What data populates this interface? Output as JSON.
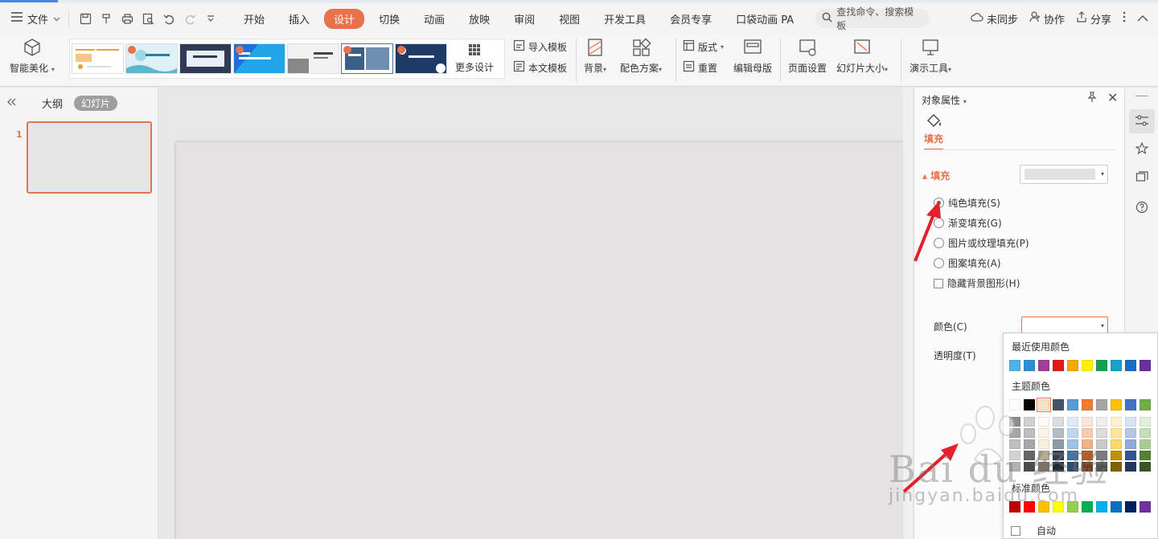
{
  "menubar": {
    "file_label": "文件",
    "tabs": [
      {
        "label": "开始",
        "active": false
      },
      {
        "label": "插入",
        "active": false
      },
      {
        "label": "设计",
        "active": true
      },
      {
        "label": "切换",
        "active": false
      },
      {
        "label": "动画",
        "active": false
      },
      {
        "label": "放映",
        "active": false
      },
      {
        "label": "审阅",
        "active": false
      },
      {
        "label": "视图",
        "active": false
      },
      {
        "label": "开发工具",
        "active": false
      },
      {
        "label": "会员专享",
        "active": false
      },
      {
        "label": "口袋动画 PA",
        "active": false
      }
    ],
    "search_placeholder": "查找命令、搜索模板",
    "unsynced": "未同步",
    "collaborate": "协作",
    "share": "分享"
  },
  "ribbon": {
    "smart_beautify": "智能美化",
    "more_design": "更多设计",
    "import_template": "导入模板",
    "this_template": "本文模板",
    "background": "背景",
    "color_scheme": "配色方案",
    "layout": "版式",
    "reset": "重置",
    "edit_master": "编辑母版",
    "page_setup": "页面设置",
    "slide_size": "幻灯片大小",
    "presentation_tools": "演示工具"
  },
  "left_panel": {
    "outline_tab": "大纲",
    "slides_tab": "幻灯片",
    "slide_number": "1"
  },
  "props": {
    "title": "对象属性",
    "subtab": "填充",
    "section": "填充",
    "options": [
      {
        "label": "纯色填充(S)",
        "selected": true
      },
      {
        "label": "渐变填充(G)",
        "selected": false
      },
      {
        "label": "图片或纹理填充(P)",
        "selected": false
      },
      {
        "label": "图案填充(A)",
        "selected": false
      }
    ],
    "hide_bg": "隐藏背景图形(H)",
    "color_label": "颜色(C)",
    "transparency_label": "透明度(T)"
  },
  "color_picker": {
    "recent_title": "最近使用颜色",
    "recent": [
      "#4fb3e8",
      "#2f8fd6",
      "#a0409a",
      "#e61919",
      "#f5a800",
      "#ffef00",
      "#16a050",
      "#17a2c8",
      "#1a6fc0",
      "#6a2fa0"
    ],
    "theme_title": "主题颜色",
    "theme_top": [
      "#ffffff",
      "#000000",
      "#f3e3c6",
      "#44546a",
      "#5b9bd5",
      "#ed7d31",
      "#a5a5a5",
      "#ffc000",
      "#4472c4",
      "#70ad47"
    ],
    "standard_title": "标准颜色",
    "standard": [
      "#c00000",
      "#ff0000",
      "#ffc000",
      "#ffff00",
      "#92d050",
      "#00b050",
      "#00b0f0",
      "#0070c0",
      "#002060",
      "#7030a0"
    ],
    "auto_label": "自动"
  },
  "watermark": {
    "brand": "Bai du 经验",
    "url": "jingyan.baidu.com"
  },
  "colors": {
    "accent": "#e8734a",
    "arrow": "#e5202a"
  }
}
